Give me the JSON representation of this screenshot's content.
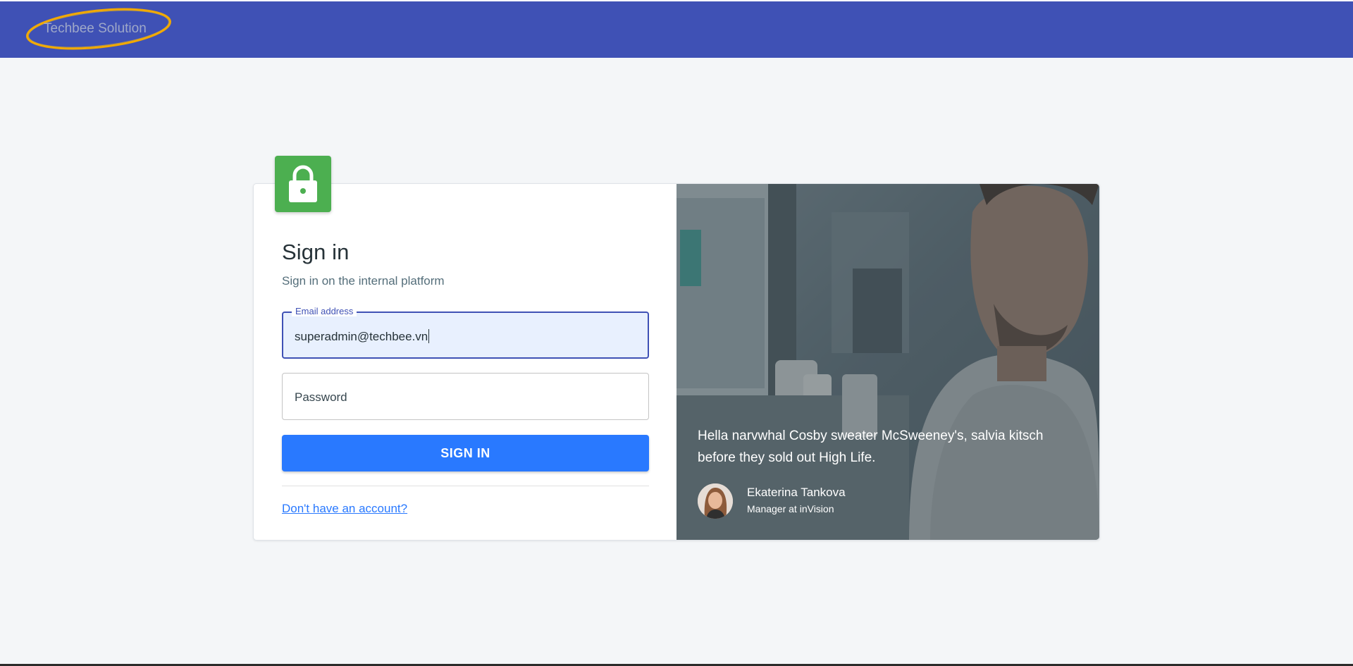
{
  "header": {
    "logo_text": "Techbee Solution"
  },
  "login": {
    "title": "Sign in",
    "subtitle": "Sign in on the internal platform",
    "email": {
      "label": "Email address",
      "value": "superadmin@techbee.vn"
    },
    "password": {
      "placeholder": "Password"
    },
    "submit_label": "SIGN IN",
    "signup_link": "Don't have an account?",
    "icons": {
      "badge": "lock-icon"
    }
  },
  "testimonial": {
    "quote": "Hella narvwhal Cosby sweater McSweeney's, salvia kitsch before they sold out High Life.",
    "author_name": "Ekaterina Tankova",
    "author_role": "Manager at inVision"
  },
  "colors": {
    "header_bg": "#3f51b5",
    "primary": "#2979ff",
    "badge": "#4caf50",
    "page_bg": "#f4f6f8"
  }
}
